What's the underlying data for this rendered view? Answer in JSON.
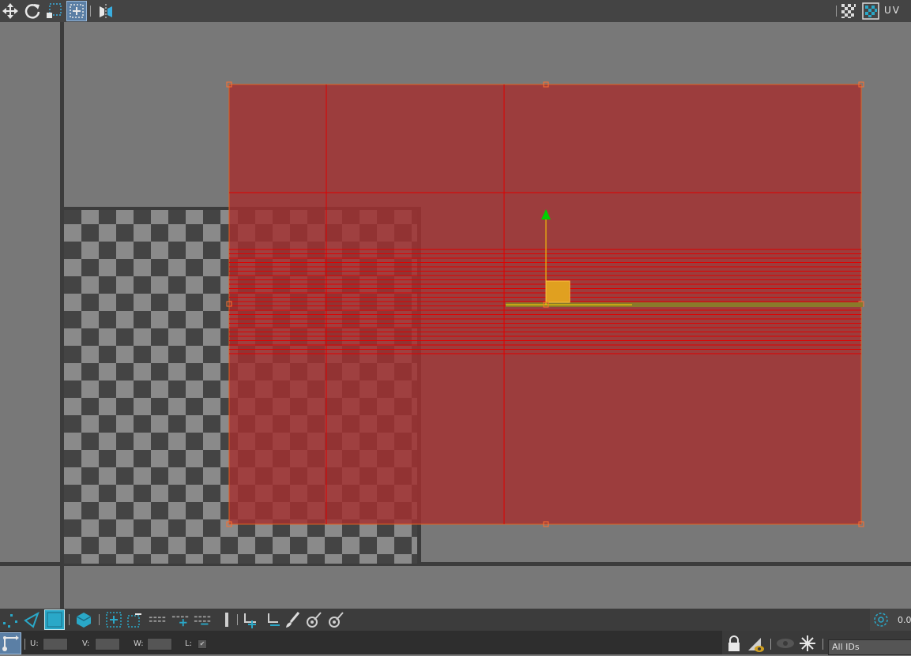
{
  "toolbar": {
    "left_tools": [
      {
        "name": "move-icon"
      },
      {
        "name": "rotate-icon"
      },
      {
        "name": "scale-icon"
      },
      {
        "name": "freeform-icon"
      },
      {
        "name": "mirror-icon"
      }
    ],
    "right_label": "UV",
    "right_tools": [
      {
        "name": "checker-pattern-icon"
      },
      {
        "name": "texture-display-icon"
      }
    ]
  },
  "bottom_tools": {
    "right_value": "0.0",
    "tool_names": [
      "vertex-select-icon",
      "edge-select-icon",
      "polygon-select-icon",
      "element-select-icon",
      "grow-selection-icon",
      "shrink-selection-icon",
      "loop-icon",
      "ring-icon",
      "loop-grow-icon",
      "shrink-loop-icon",
      "separator-bar-icon",
      "add-point-icon",
      "remove-point-icon",
      "paint-brush-icon",
      "pick-tool-icon",
      "pick-tool-alt-icon",
      "soft-selection-icon"
    ]
  },
  "status": {
    "u_label": "U:",
    "v_label": "V:",
    "w_label": "W:",
    "l_label": "L:",
    "l_check": "✔",
    "ids_dropdown": "All IDs"
  },
  "colors": {
    "toolbar_bg": "#444444",
    "viewport_bg": "#787878",
    "uv_overlay": "#a33030",
    "uv_line": "#e00000",
    "gizmo_y": "#00d000",
    "gizmo_x": "#ffd000",
    "accent": "#2aa8c8"
  }
}
